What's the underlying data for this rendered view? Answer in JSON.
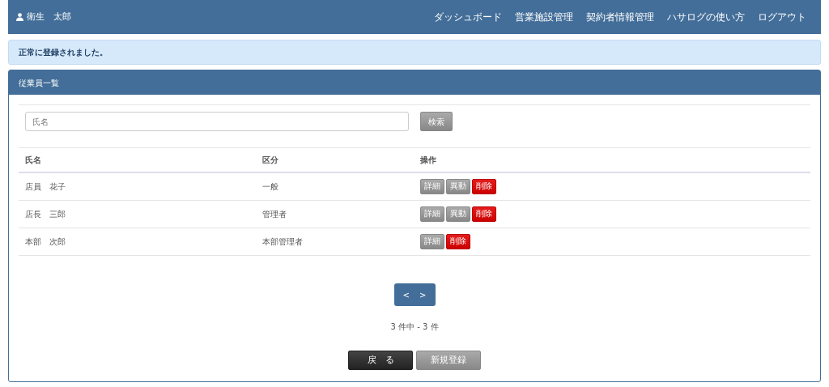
{
  "navbar": {
    "user": "衛生　太郎",
    "links": [
      "ダッシュボード",
      "営業施設管理",
      "契約者情報管理",
      "ハサログの使い方",
      "ログアウト"
    ]
  },
  "alert": "正常に登録されました。",
  "panel": {
    "title": "従業員一覧",
    "search": {
      "placeholder": "氏名",
      "button": "検索"
    },
    "table": {
      "columns": [
        "氏名",
        "区分",
        "操作"
      ],
      "rows": [
        {
          "name": "店員　花子",
          "category": "一般",
          "actions": [
            {
              "kind": "detail",
              "label": "詳細"
            },
            {
              "kind": "transfer",
              "label": "異動"
            },
            {
              "kind": "delete",
              "label": "削除"
            }
          ]
        },
        {
          "name": "店長　三郎",
          "category": "管理者",
          "actions": [
            {
              "kind": "detail",
              "label": "詳細"
            },
            {
              "kind": "transfer",
              "label": "異動"
            },
            {
              "kind": "delete",
              "label": "削除"
            }
          ]
        },
        {
          "name": "本部　次郎",
          "category": "本部管理者",
          "actions": [
            {
              "kind": "detail",
              "label": "詳細"
            },
            {
              "kind": "delete",
              "label": "削除"
            }
          ]
        }
      ]
    },
    "pager": [
      "<",
      ">"
    ],
    "count": "3 件中 - 3 件",
    "buttons": [
      {
        "kind": "back",
        "label": "戻　る"
      },
      {
        "kind": "new",
        "label": "新規登録"
      }
    ]
  }
}
